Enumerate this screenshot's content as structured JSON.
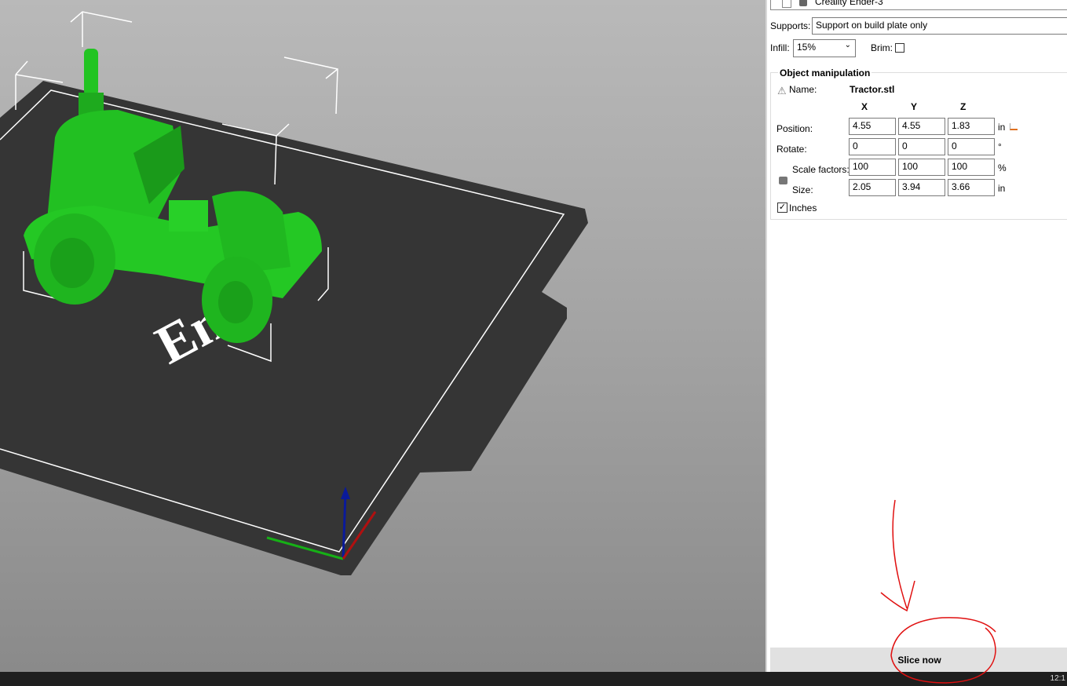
{
  "viewport": {
    "bed_logo_text": "En"
  },
  "panel": {
    "printer": "Creality Ender-3",
    "supports_label": "Supports:",
    "supports_value": "Support on build plate only",
    "infill_label": "Infill:",
    "infill_value": "15%",
    "brim_label": "Brim:",
    "brim_checked": false,
    "group_title": "Object manipulation",
    "name_label": "Name:",
    "name_value": "Tractor.stl",
    "axes": [
      "X",
      "Y",
      "Z"
    ],
    "rows": [
      {
        "label": "Position:",
        "values": [
          "4.55",
          "4.55",
          "1.83"
        ],
        "unit": "in"
      },
      {
        "label": "Rotate:",
        "values": [
          "0",
          "0",
          "0"
        ],
        "unit": "°"
      },
      {
        "label": "Scale factors:",
        "values": [
          "100",
          "100",
          "100"
        ],
        "unit": "%"
      },
      {
        "label": "Size:",
        "values": [
          "2.05",
          "3.94",
          "3.66"
        ],
        "unit": "in"
      }
    ],
    "inches_label": "Inches",
    "inches_checked": true,
    "slice_button": "Slice now"
  },
  "taskbar": {
    "clock": "12:1"
  },
  "colors": {
    "model": "#1fc41f",
    "bed": "#333333",
    "annotation": "#e01010"
  }
}
